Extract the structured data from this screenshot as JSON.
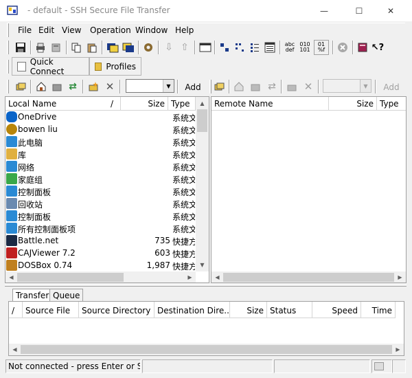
{
  "window": {
    "title": "- default - SSH Secure File Transfer",
    "app_icon": "ssh-sft-icon",
    "minimize": "—",
    "maximize": "☐",
    "close": "✕"
  },
  "menu": {
    "items": [
      {
        "label": "File",
        "key": "F"
      },
      {
        "label": "Edit",
        "key": "E"
      },
      {
        "label": "View",
        "key": "V"
      },
      {
        "label": "Operation",
        "key": "O"
      },
      {
        "label": "Window",
        "key": "W"
      },
      {
        "label": "Help",
        "key": "H"
      }
    ]
  },
  "toolbar": {
    "quick_connect": "Quick Connect",
    "profiles": "Profiles",
    "local_add": "Add",
    "remote_add": "Add",
    "abc_top": "abc",
    "abc_bottom": "def",
    "bin_top": "010",
    "bin_bottom": "101",
    "auto_top": "01",
    "auto_bottom": "%f"
  },
  "local": {
    "headers": {
      "name": "Local Name",
      "sort": "/",
      "size": "Size",
      "type": "Type"
    },
    "rows": [
      {
        "name": "OneDrive",
        "size": "",
        "type": "系统文",
        "icon": "cloud-icon",
        "color": "#0a64c8"
      },
      {
        "name": "bowen liu",
        "size": "",
        "type": "系统文",
        "icon": "user-icon",
        "color": "#b8860b"
      },
      {
        "name": "此电脑",
        "size": "",
        "type": "系统文",
        "icon": "computer-icon",
        "color": "#2a8ad4"
      },
      {
        "name": "库",
        "size": "",
        "type": "系统文",
        "icon": "library-icon",
        "color": "#e0b040"
      },
      {
        "name": "网络",
        "size": "",
        "type": "系统文",
        "icon": "network-icon",
        "color": "#2a8ad4"
      },
      {
        "name": "家庭组",
        "size": "",
        "type": "系统文",
        "icon": "homegroup-icon",
        "color": "#3aa84a"
      },
      {
        "name": "控制面板",
        "size": "",
        "type": "系统文",
        "icon": "control-panel-icon",
        "color": "#2a8ad4"
      },
      {
        "name": "回收站",
        "size": "",
        "type": "系统文",
        "icon": "recycle-bin-icon",
        "color": "#6a8ab0"
      },
      {
        "name": "控制面板",
        "size": "",
        "type": "系统文",
        "icon": "control-panel-icon",
        "color": "#2a8ad4"
      },
      {
        "name": "所有控制面板项",
        "size": "",
        "type": "系统文",
        "icon": "control-panel-icon",
        "color": "#2a8ad4"
      },
      {
        "name": "Battle.net",
        "size": "735",
        "type": "快捷方",
        "icon": "battlenet-icon",
        "color": "#1b2a44"
      },
      {
        "name": "CAJViewer 7.2",
        "size": "603",
        "type": "快捷方",
        "icon": "cajviewer-icon",
        "color": "#c02020"
      },
      {
        "name": "DOSBox 0.74",
        "size": "1,987",
        "type": "快捷方",
        "icon": "dosbox-icon",
        "color": "#c08020"
      }
    ]
  },
  "remote": {
    "headers": {
      "name": "Remote Name",
      "size": "Size",
      "type": "Type"
    }
  },
  "transfer": {
    "tabs": [
      "Transfer",
      "Queue"
    ],
    "headers": {
      "sort": "/",
      "source_file": "Source File",
      "source_dir": "Source Directory",
      "dest_dir": "Destination Dire...",
      "size": "Size",
      "status": "Status",
      "speed": "Speed",
      "time": "Time"
    }
  },
  "status": {
    "text": "Not connected - press Enter or S"
  },
  "colors": {
    "accent": "#0a64c8",
    "chrome": "#f0f0f0",
    "border": "#a0a0a0"
  }
}
